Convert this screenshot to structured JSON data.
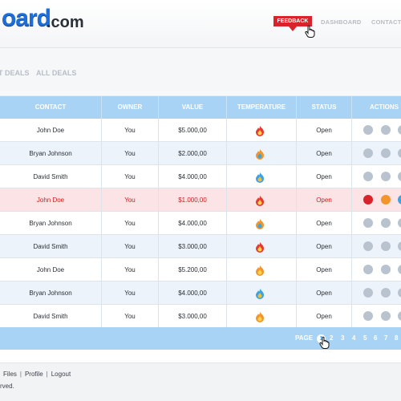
{
  "header": {
    "logo_text": "oard",
    "logo_tld": ".com",
    "feedback_label": "FEEDBACK",
    "nav": [
      "DASHBOARD",
      "CONTACTS"
    ]
  },
  "subnav": {
    "tabs": [
      "T DEALS",
      "ALL DEALS"
    ]
  },
  "table": {
    "columns": [
      "CONTACT",
      "OWNER",
      "VALUE",
      "TEMPERATURE",
      "STATUS",
      "ACTIONS"
    ],
    "rows": [
      {
        "contact": "John Doe",
        "owner": "You",
        "value": "$5.000,00",
        "temperature": "hot",
        "status": "Open"
      },
      {
        "contact": "Bryan Johnson",
        "owner": "You",
        "value": "$2.000,00",
        "temperature": "warm",
        "status": "Open"
      },
      {
        "contact": "David Smith",
        "owner": "You",
        "value": "$4.000,00",
        "temperature": "cold",
        "status": "Open"
      },
      {
        "contact": "John Doe",
        "owner": "You",
        "value": "$1.000,00",
        "temperature": "hot",
        "status": "Open"
      },
      {
        "contact": "Bryan Johnson",
        "owner": "You",
        "value": "$4.000,00",
        "temperature": "warm",
        "status": "Open"
      },
      {
        "contact": "David Smith",
        "owner": "You",
        "value": "$3.000,00",
        "temperature": "hot",
        "status": "Open"
      },
      {
        "contact": "John Doe",
        "owner": "You",
        "value": "$5.200,00",
        "temperature": "warm",
        "status": "Open"
      },
      {
        "contact": "Bryan Johnson",
        "owner": "You",
        "value": "$4.000,00",
        "temperature": "cold",
        "status": "Open"
      },
      {
        "contact": "David Smith",
        "owner": "You",
        "value": "$3.000,00",
        "temperature": "warm",
        "status": "Open"
      }
    ]
  },
  "pagination": {
    "label": "PAGE",
    "current": "1",
    "pages": [
      "2",
      "3",
      "4",
      "5",
      "6",
      "7",
      "8"
    ]
  },
  "footer": {
    "links": [
      "Files",
      "Profile",
      "Logout"
    ],
    "link_prefix": "",
    "separator": "|",
    "copyright": "rved."
  },
  "colors": {
    "accent": "#a9d3f4",
    "feedback": "#d8232a",
    "highlight_row": "#fbe3e6",
    "icon_hot": "#e53a2f",
    "icon_warm": "#f2952b",
    "icon_cold": "#3aa3e4"
  }
}
